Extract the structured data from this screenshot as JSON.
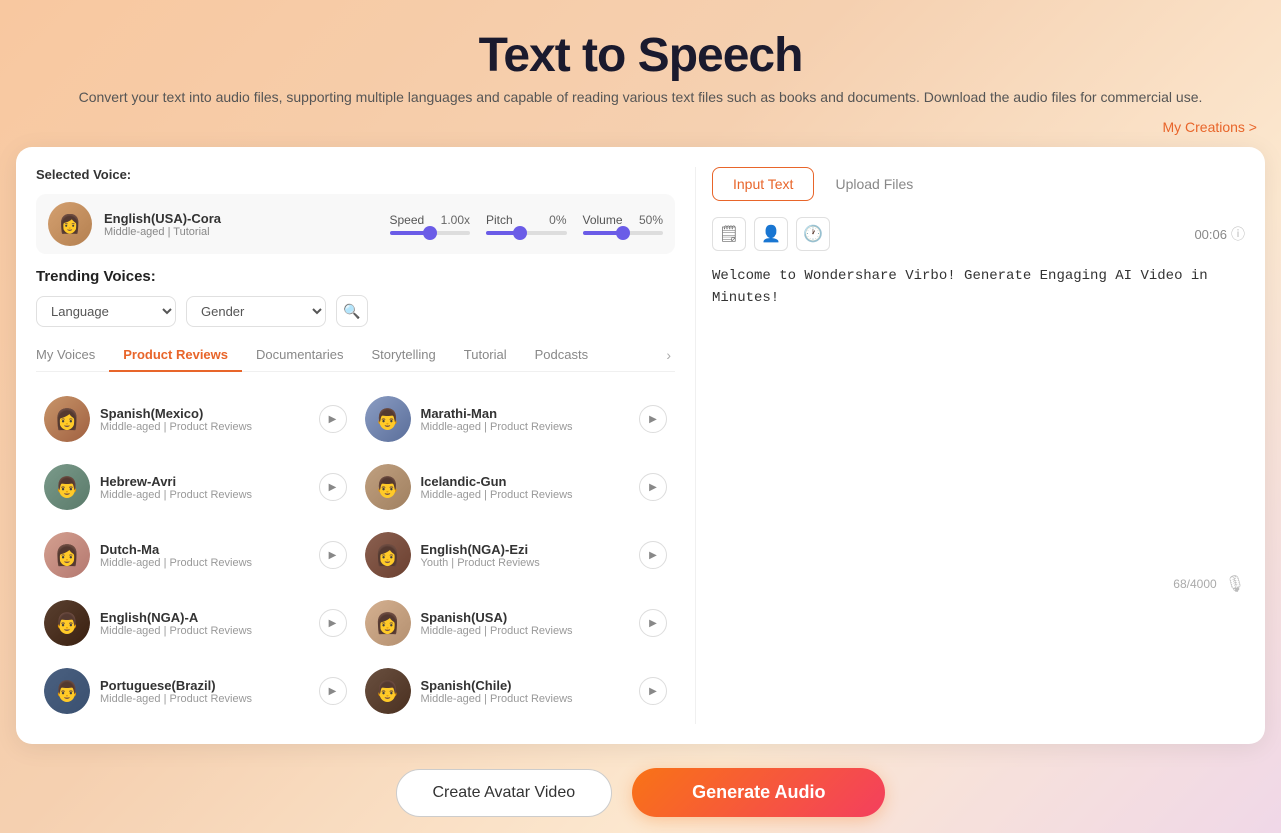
{
  "header": {
    "title": "Text to Speech",
    "subtitle": "Convert your text into audio files, supporting multiple languages and capable of reading various text files such as books and documents. Download the audio files for commercial use.",
    "my_creations_label": "My Creations >"
  },
  "selected_voice": {
    "label": "Selected Voice:",
    "name": "English(USA)-Cora",
    "meta": "Middle-aged | Tutorial"
  },
  "sliders": {
    "speed_label": "Speed",
    "speed_value": "1.00x",
    "pitch_label": "Pitch",
    "pitch_value": "0%",
    "volume_label": "Volume",
    "volume_value": "50%"
  },
  "trending": {
    "label": "Trending Voices:",
    "language_placeholder": "Language",
    "gender_placeholder": "Gender"
  },
  "tabs": [
    {
      "label": "My Voices",
      "active": false
    },
    {
      "label": "Product Reviews",
      "active": true
    },
    {
      "label": "Documentaries",
      "active": false
    },
    {
      "label": "Storytelling",
      "active": false
    },
    {
      "label": "Tutorial",
      "active": false
    },
    {
      "label": "Podcasts",
      "active": false
    }
  ],
  "voices": [
    {
      "id": "v1",
      "name": "Spanish(Mexico)",
      "meta": "Middle-aged | Product Reviews",
      "avatar_class": "av-spanish-mexico"
    },
    {
      "id": "v2",
      "name": "Marathi-Man",
      "meta": "Middle-aged | Product Reviews",
      "avatar_class": "av-marathi-man"
    },
    {
      "id": "v3",
      "name": "Hebrew-Avri",
      "meta": "Middle-aged | Product Reviews",
      "avatar_class": "av-hebrew-avri"
    },
    {
      "id": "v4",
      "name": "Icelandic-Gun",
      "meta": "Middle-aged | Product Reviews",
      "avatar_class": "av-icelandic-gun"
    },
    {
      "id": "v5",
      "name": "Dutch-Ma",
      "meta": "Middle-aged | Product Reviews",
      "avatar_class": "av-dutch-ma"
    },
    {
      "id": "v6",
      "name": "English(NGA)-Ezi",
      "meta": "Youth | Product Reviews",
      "avatar_class": "av-english-nga-ezi"
    },
    {
      "id": "v7",
      "name": "English(NGA)-A",
      "meta": "Middle-aged | Product Reviews",
      "avatar_class": "av-english-nga-a"
    },
    {
      "id": "v8",
      "name": "Spanish(USA)",
      "meta": "Middle-aged | Product Reviews",
      "avatar_class": "av-spanish-usa"
    },
    {
      "id": "v9",
      "name": "Portuguese(Brazil)",
      "meta": "Middle-aged | Product Reviews",
      "avatar_class": "av-portuguese-brazil"
    },
    {
      "id": "v10",
      "name": "Spanish(Chile)",
      "meta": "Middle-aged | Product Reviews",
      "avatar_class": "av-spanish-chile"
    }
  ],
  "text_panel": {
    "input_tab": "Input Text",
    "upload_tab": "Upload Files",
    "time_display": "00:06",
    "sample_text": "Welcome to Wondershare Virbo! Generate Engaging AI Video in Minutes!",
    "char_count": "68/4000"
  },
  "bottom_buttons": {
    "create_avatar": "Create Avatar Video",
    "generate_audio": "Generate Audio"
  }
}
